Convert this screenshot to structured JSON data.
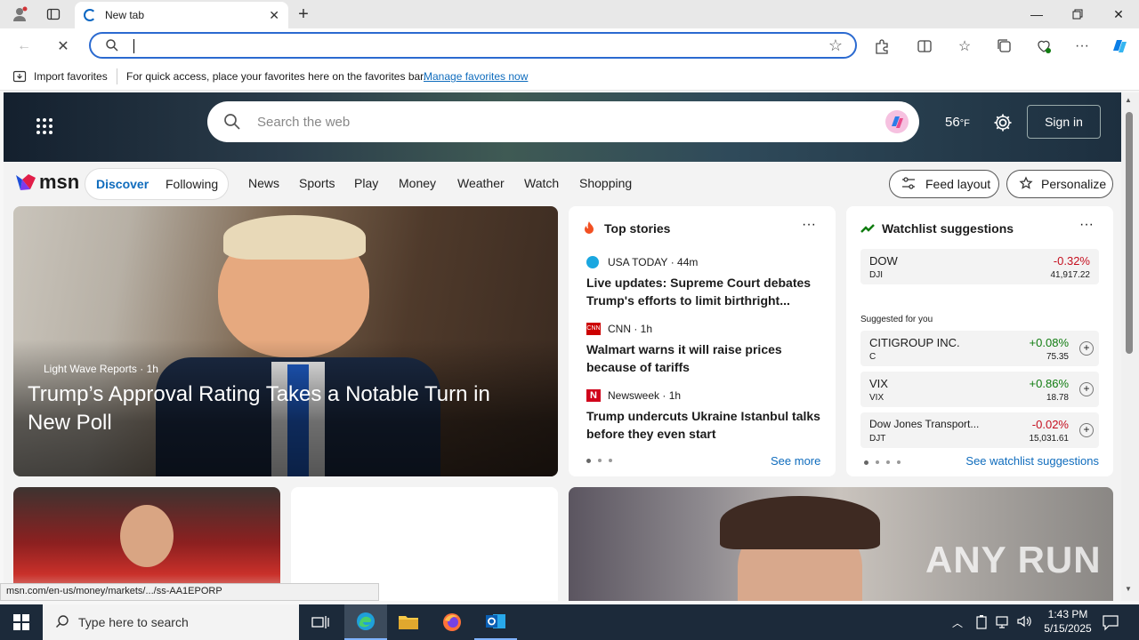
{
  "browser": {
    "tab_title": "New tab",
    "address_value": "",
    "favbar": {
      "import_label": "Import favorites",
      "hint": "For quick access, place your favorites here on the favorites bar.",
      "manage_link": "Manage favorites now"
    },
    "status_url": "msn.com/en-us/money/markets/.../ss-AA1EPORP"
  },
  "msn": {
    "search_placeholder": "Search the web",
    "temperature": "56",
    "temp_unit": "°F",
    "sign_in": "Sign in",
    "logo_text": "msn",
    "tabs": [
      "Discover",
      "Following"
    ],
    "nav": [
      "News",
      "Sports",
      "Play",
      "Money",
      "Weather",
      "Watch",
      "Shopping"
    ],
    "feed_layout": "Feed layout",
    "personalize": "Personalize",
    "hero": {
      "source": "Light Wave Reports",
      "age": "1h",
      "headline": "Trump’s Approval Rating Takes a Notable Turn in New Poll"
    },
    "top_stories": {
      "title": "Top stories",
      "items": [
        {
          "source": "USA TODAY",
          "age": "44m",
          "headline": "Live updates: Supreme Court debates Trump's efforts to limit birthright..."
        },
        {
          "source": "CNN",
          "age": "1h",
          "headline": "Walmart warns it will raise prices because of tariffs"
        },
        {
          "source": "Newsweek",
          "age": "1h",
          "headline": "Trump undercuts Ukraine Istanbul talks before they even start"
        }
      ],
      "see_more": "See more"
    },
    "watchlist": {
      "title": "Watchlist suggestions",
      "main": {
        "name": "DOW",
        "symbol": "DJI",
        "change": "-0.32%",
        "price": "41,917.22"
      },
      "suggested_label": "Suggested for you",
      "items": [
        {
          "name": "CITIGROUP INC.",
          "symbol": "C",
          "change": "+0.08%",
          "price": "75.35"
        },
        {
          "name": "VIX",
          "symbol": "VIX",
          "change": "+0.86%",
          "price": "18.78"
        },
        {
          "name": "Dow Jones Transport...",
          "symbol": "DJT",
          "change": "-0.02%",
          "price": "15,031.61"
        }
      ],
      "see_link": "See watchlist suggestions"
    }
  },
  "taskbar": {
    "search_placeholder": "Type here to search",
    "time": "1:43 PM",
    "date": "5/15/2025"
  },
  "watermark": "ANY RUN",
  "colors": {
    "accent": "#0f6cbd",
    "up": "#107c10",
    "down": "#c50f1f",
    "taskbar": "#1c2a3a"
  }
}
